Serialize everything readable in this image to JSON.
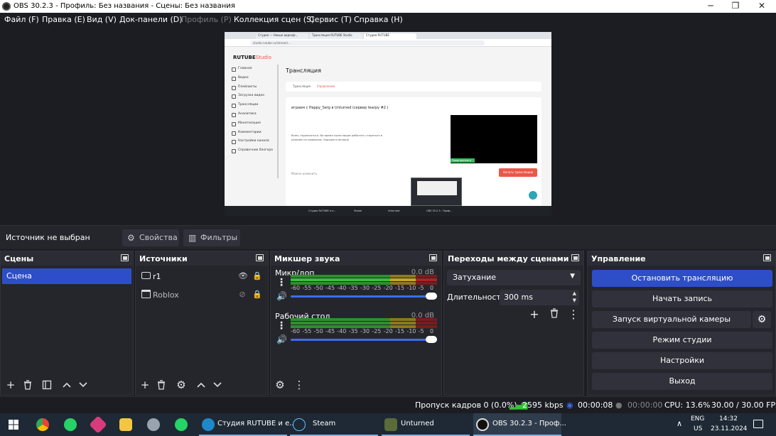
{
  "window": {
    "title": "OBS 30.2.3 - Профиль: Без названия - Сцены: Без названия"
  },
  "menu": [
    "Файл (F)",
    "Правка (E)",
    "Вид (V)",
    "Док-панели (D)",
    "Профиль (P)",
    "Коллекция сцен (S)",
    "Сервис (T)",
    "Справка (H)"
  ],
  "preview": {
    "tabs": [
      "Студия — Новые видеоф...",
      "Трансляция RUTUBE Studio",
      "Студия RUTUBE"
    ],
    "url": "studio.rutube.ru/stream/...",
    "brand": "RUTUBE",
    "brand_suffix": "Studio",
    "nav": [
      "Главная",
      "Видео",
      "Плейлисты",
      "Загрузка видео",
      "Трансляции",
      "Аналитика",
      "Монетизация",
      "Комментарии",
      "Настройки канала",
      "Справочник блогера"
    ],
    "page_title": "Трансляция",
    "subtabs": [
      "Трансляция",
      "Управление"
    ],
    "stream_title": "играем с Happy_Serg в Unturned (сервер tearpy #2 )",
    "description": "Всем, подписаться. Во время трансляции работать стараться в режиме по правилам. Хорошего вечера!",
    "preview_label": "Предпросмотр",
    "button": "Начать трансляцию",
    "more": "Можно изменить",
    "taskbar": [
      "Студия RUTUBE и е...",
      "Steam",
      "Unturned",
      "OBS 30.2.3 - Проф..."
    ]
  },
  "source_bar": {
    "no_source": "Источник не выбран",
    "properties": "Свойства",
    "filters": "Фильтры"
  },
  "scenes": {
    "title": "Сцены",
    "items": [
      "Сцена"
    ]
  },
  "sources": {
    "title": "Источники",
    "items": [
      {
        "name": "r1",
        "icon": "monitor-icon",
        "visible": true
      },
      {
        "name": "Roblox",
        "icon": "window-icon",
        "visible": false
      }
    ]
  },
  "mixer": {
    "title": "Микшер звука",
    "channels": [
      {
        "name": "Микр/доп",
        "db": "0.0 dB"
      },
      {
        "name": "Рабочий стол",
        "db": "0.0 dB"
      }
    ],
    "scale": [
      "-60",
      "-55",
      "-50",
      "-45",
      "-40",
      "-35",
      "-30",
      "-25",
      "-20",
      "-15",
      "-10",
      "-5",
      "0"
    ]
  },
  "transitions": {
    "title": "Переходы между сценами",
    "selected": "Затухание",
    "duration_label": "Длительность",
    "duration": "300 ms"
  },
  "controls": {
    "title": "Управление",
    "buttons": [
      "Остановить трансляцию",
      "Начать запись",
      "Запуск виртуальной камеры",
      "Режим студии",
      "Настройки",
      "Выход"
    ]
  },
  "status": {
    "dropped": "Пропуск кадров 0 (0.0%)",
    "bitrate": "2595 kbps",
    "stream_time": "00:00:08",
    "rec_time": "00:00:00",
    "cpu": "CPU: 13.6%",
    "fps": "30.00 / 30.00 FPS"
  },
  "taskbar": {
    "apps": [
      {
        "label": "Студия RUTUBE и е...",
        "icon": "edge-icon"
      },
      {
        "label": "Steam",
        "icon": "steam-icon"
      },
      {
        "label": "Unturned",
        "icon": "unturned-icon"
      },
      {
        "label": "OBS 30.2.3 - Проф...",
        "icon": "obs-icon"
      }
    ],
    "lang1": "ENG",
    "lang2": "US",
    "time": "14:32",
    "date": "23.11.2024"
  },
  "colors": {
    "accent": "#2e4ec9",
    "panel": "#25262c",
    "bg": "#1c1d22"
  }
}
